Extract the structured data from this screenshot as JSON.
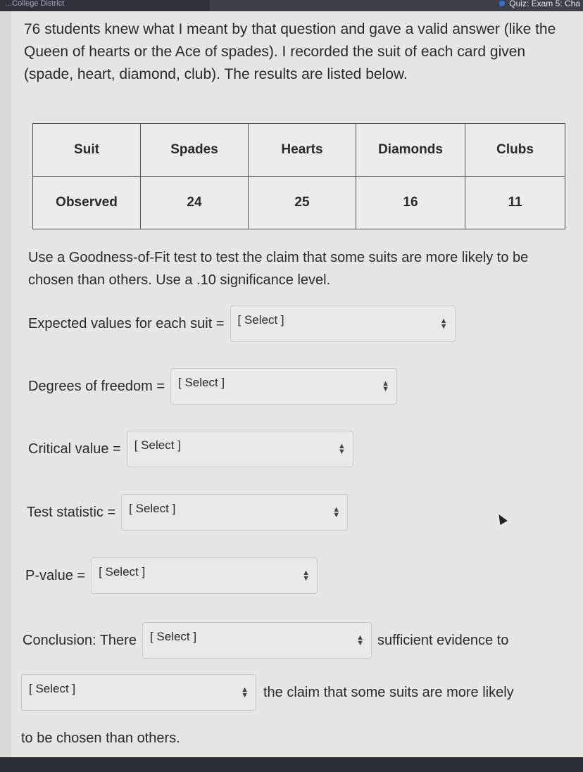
{
  "header": {
    "left_text": "...College District",
    "quiz_title": "Quiz: Exam 5: Cha"
  },
  "intro": "76 students knew what I meant by that question and gave a valid answer (like the Queen of hearts or the Ace of spades).  I recorded the suit of each card given (spade, heart, diamond, club).  The results are listed below.",
  "table": {
    "headers": [
      "Suit",
      "Spades",
      "Hearts",
      "Diamonds",
      "Clubs"
    ],
    "rows": [
      [
        "Observed",
        "24",
        "25",
        "16",
        "11"
      ]
    ]
  },
  "question": "Use a Goodness-of-Fit test to test the claim that some suits are more likely to be chosen than others.  Use a .10 significance level.",
  "fields": [
    {
      "label": "Expected values for each suit =",
      "value": "[ Select ]"
    },
    {
      "label": "Degrees of freedom =",
      "value": "[ Select ]"
    },
    {
      "label": "Critical value =",
      "value": "[ Select ]"
    },
    {
      "label": "Test statistic =",
      "value": "[ Select ]"
    },
    {
      "label": "P-value =",
      "value": "[ Select ]"
    }
  ],
  "conclusion": {
    "prefix": "Conclusion:  There",
    "select1": "[ Select ]",
    "middle": "sufficient evidence to",
    "select2": "[ Select ]",
    "suffix": "the claim that some suits are more likely",
    "end": "to be chosen than others."
  },
  "icons": {
    "select": "updown-arrows-icon"
  }
}
